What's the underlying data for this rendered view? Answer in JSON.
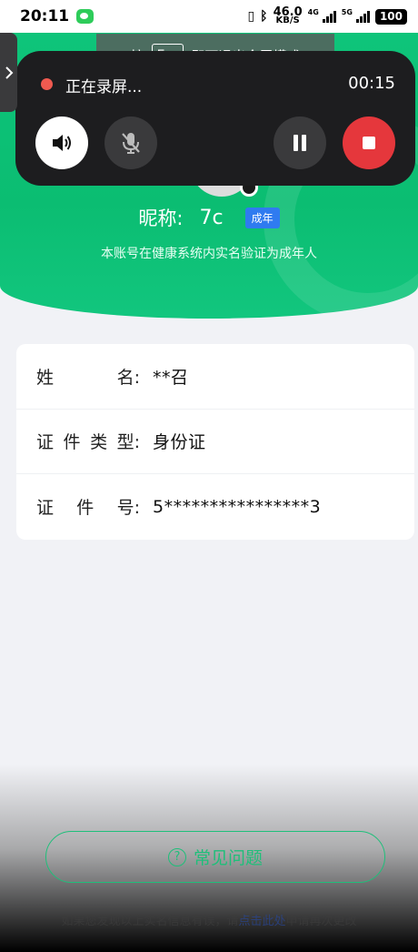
{
  "status_bar": {
    "time": "20:11",
    "net_speed_value": "46.0",
    "net_speed_unit": "KB/S",
    "signal1_label": "4G",
    "signal2_label": "5G",
    "battery": "100"
  },
  "fullscreen_toast": {
    "prefix": "按",
    "key": "Esc",
    "suffix": "即可退出全屏模式"
  },
  "recording": {
    "status": "正在录屏...",
    "timer": "00:15"
  },
  "profile": {
    "nickname_label": "昵称:",
    "nickname": "7c",
    "badge": "成年",
    "verify_note": "本账号在健康系统内实名验证为成年人"
  },
  "info_rows": [
    {
      "label_chars": [
        "姓",
        "名:"
      ],
      "value": "**召"
    },
    {
      "label_chars": [
        "证",
        "件",
        "类",
        "型:"
      ],
      "value": "身份证"
    },
    {
      "label_chars": [
        "证",
        "件",
        "号:"
      ],
      "value": "5****************3"
    }
  ],
  "faq": {
    "label": "常见问题"
  },
  "footer": {
    "prefix": "如果您发现以上实名信息有误，请",
    "link": "点击此处",
    "suffix": "申请再次更改"
  },
  "colors": {
    "brand_green": "#0ec47a",
    "badge_blue": "#2f7bf0",
    "record_red": "#e5373c"
  }
}
